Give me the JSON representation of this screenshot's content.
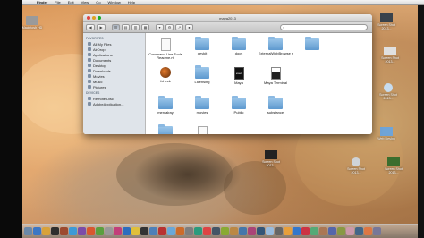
{
  "menubar": {
    "apple": "",
    "app": "Finder",
    "items": [
      "File",
      "Edit",
      "View",
      "Go",
      "Window",
      "Help"
    ]
  },
  "finder": {
    "title": "maya2013",
    "toolbar": {
      "back": "◀",
      "forward": "▶",
      "views": [
        "☰",
        "▤",
        "▥",
        "▦"
      ]
    },
    "search_placeholder": "",
    "sidebar": {
      "favorites_header": "FAVORITES",
      "favorites": [
        "All My Files",
        "AirDrop",
        "Applications",
        "Documents",
        "Desktop",
        "Downloads",
        "Movies",
        "Music",
        "Pictures"
      ],
      "devices_header": "DEVICES",
      "devices": [
        "Remote Disc",
        "AdobeApplication..."
      ]
    },
    "files": [
      {
        "name": "Command Line Tools Readme.rtf",
        "type": "doc"
      },
      {
        "name": "devkit",
        "type": "folder"
      },
      {
        "name": "docs",
        "type": "folder"
      },
      {
        "name": "ExternalWebBrowse r",
        "type": "folder"
      },
      {
        "name": "",
        "type": "folder"
      },
      {
        "name": "fcheck",
        "type": "app"
      },
      {
        "name": "Licensing",
        "type": "folder"
      },
      {
        "name": "Maya",
        "type": "exec"
      },
      {
        "name": "Maya Terminal",
        "type": "term"
      },
      {
        "name": "",
        "type": "blank"
      },
      {
        "name": "mentalray",
        "type": "folder"
      },
      {
        "name": "movies",
        "type": "folder"
      },
      {
        "name": "Public",
        "type": "folder"
      },
      {
        "name": "substance",
        "type": "folder"
      },
      {
        "name": "",
        "type": "blank"
      }
    ]
  },
  "desktop": {
    "icons": [
      {
        "label": "Macintosh HD",
        "color": "#9a9a9a"
      },
      {
        "label": "Screen Shot 2013...",
        "color": "#39424c"
      },
      {
        "label": "Screen Shot 2013...",
        "color": "#e0e0e0"
      },
      {
        "label": "Screen Shot 2013...",
        "color": "#c7dcef"
      },
      {
        "label": "Web Design",
        "color": "#6fa4d8"
      },
      {
        "label": "Screen Shot 2013...",
        "color": "#222222"
      },
      {
        "label": "Screen Shot 2013...",
        "color": "#cfd3d7"
      },
      {
        "label": "Screen Shot 2013...",
        "color": "#3b6e2e"
      }
    ]
  },
  "dock": {
    "colors": [
      "#6b88a8",
      "#3c77c5",
      "#d8a23a",
      "#2e2e2e",
      "#9c4a2f",
      "#3d9ad6",
      "#7b4ca8",
      "#d8572f",
      "#5a9f3e",
      "#999999",
      "#c23f7a",
      "#2c6dbf",
      "#e0c03a",
      "#333333",
      "#4d80b8",
      "#b83232",
      "#6aa8d8",
      "#cc6b2a",
      "#7e7e7e",
      "#2b9b7d",
      "#d44",
      "#445566",
      "#88aa33",
      "#bb8844",
      "#4477aa",
      "#aa4477",
      "#335577",
      "#99bbdd",
      "#666666",
      "#e89f3b",
      "#3377cc",
      "#cc3344",
      "#55aa77",
      "#aa7755",
      "#5566aa",
      "#889944",
      "#cc99aa",
      "#446688",
      "#dd7744",
      "#777799"
    ]
  }
}
